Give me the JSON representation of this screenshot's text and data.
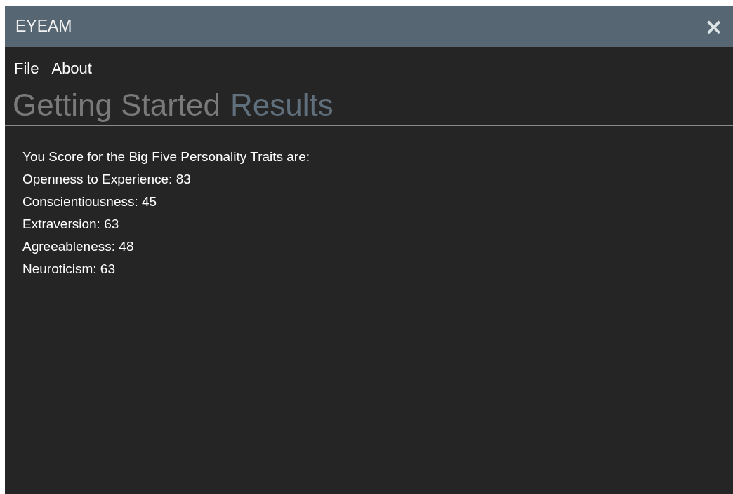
{
  "window": {
    "title": "EYEAM",
    "close": "×"
  },
  "menu": [
    "File",
    "About"
  ],
  "tabs": [
    {
      "label": "Getting Started",
      "selected": false
    },
    {
      "label": "Results",
      "selected": true
    }
  ],
  "content": {
    "lines": [
      "You Score for the Big Five Personality Traits are:",
      "Openness to Experience: 83",
      "Conscientiousness: 45",
      "Extraversion: 63",
      "Agreeableness: 48",
      "Neuroticism: 63"
    ]
  }
}
